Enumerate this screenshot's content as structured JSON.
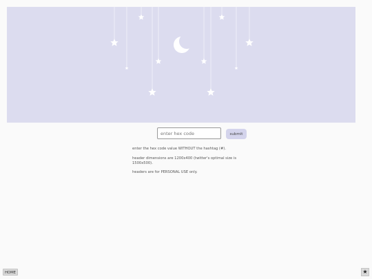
{
  "form": {
    "hex_placeholder": "enter hex code",
    "submit_label": "submit"
  },
  "info": {
    "line1": "enter the hex code value WITHOUT the hashtag (#).",
    "line2": "header dimensions are 1200x400 (twitter's optimal size is 1500x500).",
    "line3": "headers are for PERSONAL USE only."
  },
  "footer": {
    "home_label": "HOME",
    "star_icon": "star-icon"
  },
  "colors": {
    "header_background": "#dcdcef",
    "ornament": "#ffffff"
  }
}
